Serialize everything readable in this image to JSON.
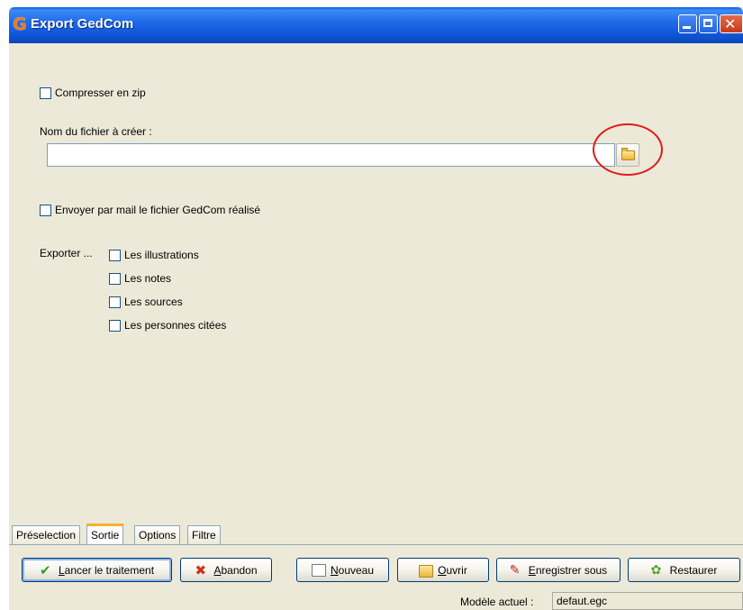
{
  "window": {
    "title": "Export GedCom",
    "app_icon_letter": "G"
  },
  "options": {
    "compress_zip": {
      "label": "Compresser en zip",
      "checked": false
    },
    "filename_label": "Nom du fichier à créer :",
    "filename_value": "",
    "send_mail": {
      "label": "Envoyer par mail le fichier GedCom réalisé",
      "checked": false
    },
    "export_label": "Exporter ...",
    "export_items": [
      {
        "label": "Les illustrations",
        "checked": false
      },
      {
        "label": "Les notes",
        "checked": false
      },
      {
        "label": "Les sources",
        "checked": false
      },
      {
        "label": "Les personnes citées",
        "checked": false
      }
    ]
  },
  "tabs": [
    {
      "label": "Préselection",
      "active": false
    },
    {
      "label": "Sortie",
      "active": true
    },
    {
      "label": "Options",
      "active": false
    },
    {
      "label": "Filtre",
      "active": false
    }
  ],
  "buttons": {
    "run": {
      "pre": "",
      "accel": "L",
      "post": "ancer le traitement",
      "icon": "check-icon"
    },
    "abort": {
      "pre": "",
      "accel": "A",
      "post": "bandon",
      "icon": "cross-icon"
    },
    "new": {
      "pre": "",
      "accel": "N",
      "post": "ouveau",
      "icon": "new-document-icon"
    },
    "open": {
      "pre": "",
      "accel": "O",
      "post": "uvrir",
      "icon": "open-folder-icon"
    },
    "save_as": {
      "pre": "",
      "accel": "E",
      "post": "nregistrer sous",
      "icon": "save-as-icon"
    },
    "restore": {
      "label": "Restaurer",
      "icon": "restore-icon"
    }
  },
  "model": {
    "label": "Modèle actuel :",
    "value": "defaut.egc"
  },
  "colors": {
    "titlebar": "#0A5FE0",
    "annotation": "#E01A1A",
    "active_tab": "#F7B12E"
  }
}
